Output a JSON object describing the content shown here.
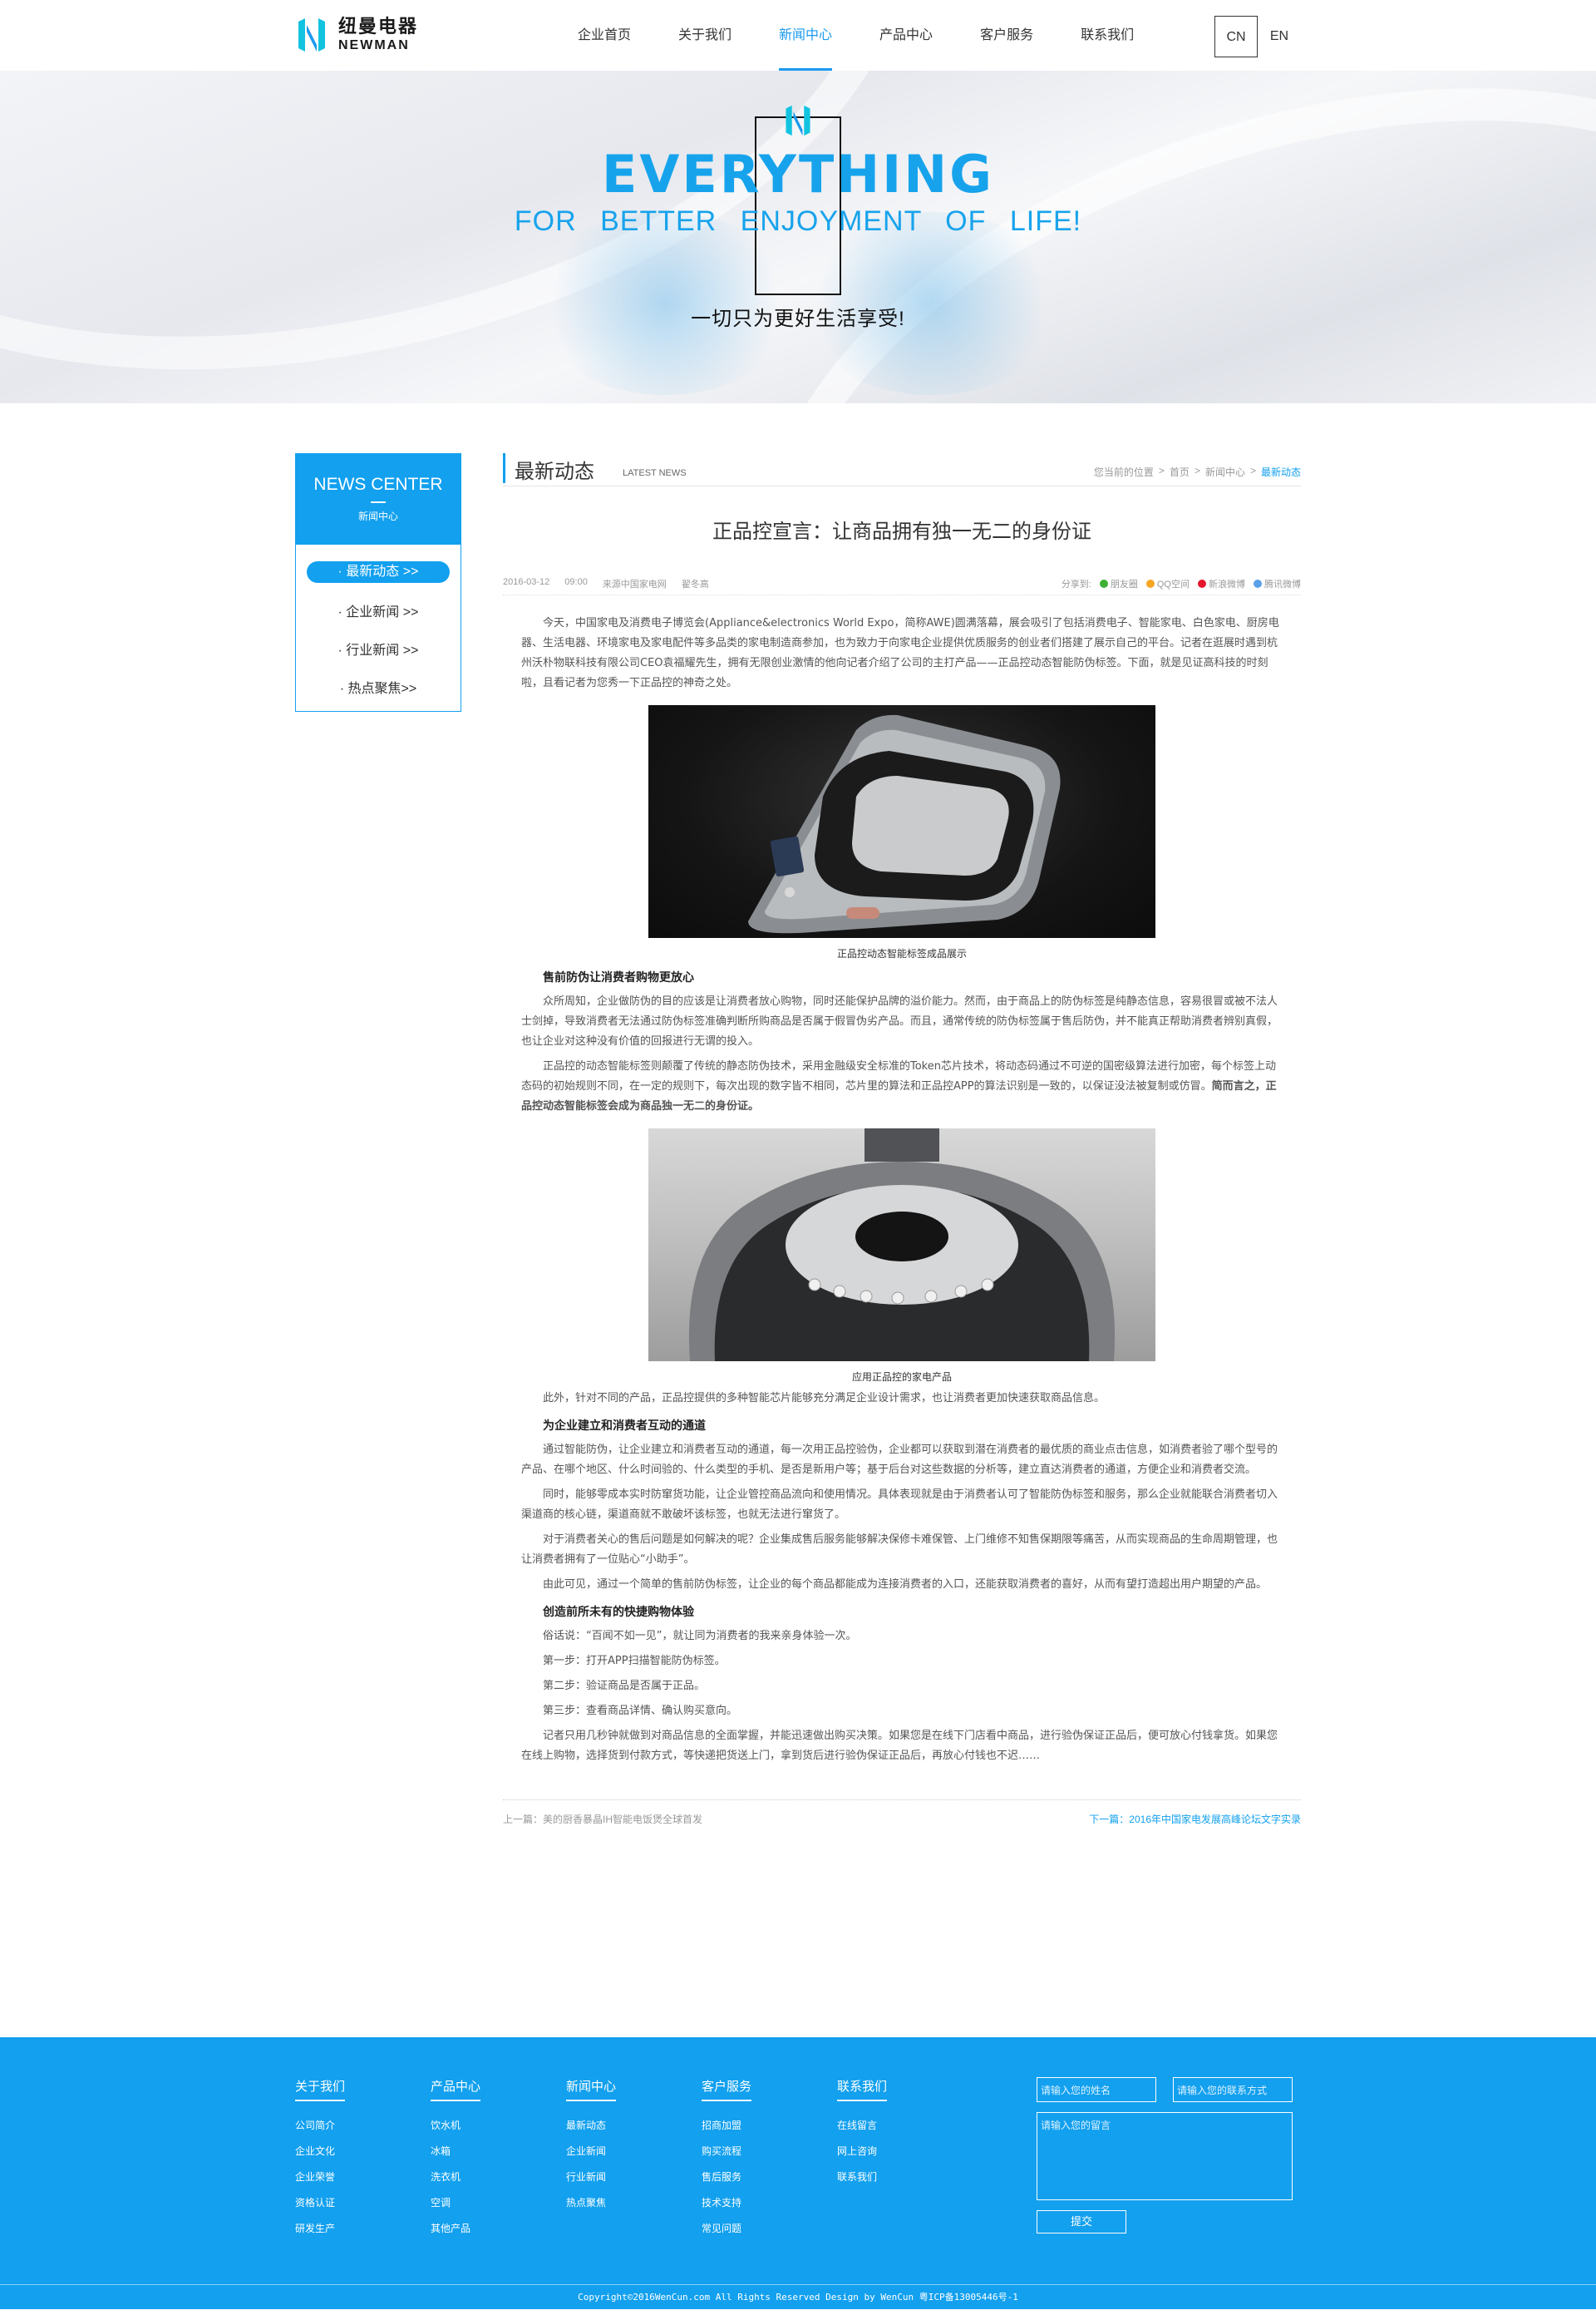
{
  "header": {
    "logo_cn": "纽曼电器",
    "logo_en": "NEWMAN",
    "nav": [
      "企业首页",
      "关于我们",
      "新闻中心",
      "产品中心",
      "客户服务",
      "联系我们"
    ],
    "nav_active_index": 2,
    "lang": [
      "CN",
      "EN"
    ]
  },
  "banner": {
    "title": "EVERYTHING",
    "subtitle": "FOR BETTER ENJOYMENT OF LIFE!",
    "cn": "一切只为更好生活享受!"
  },
  "sidebar": {
    "title_en": "NEWS CENTER",
    "title_cn": "新闻中心",
    "items": [
      "· 最新动态 >>",
      "· 企业新闻 >>",
      "· 行业新闻 >>",
      "· 热点聚焦>>"
    ]
  },
  "content": {
    "title": "最新动态",
    "title_en": "LATEST NEWS",
    "breadcrumb": [
      "您当前的位置",
      ">",
      "首页",
      ">",
      "新闻中心",
      ">",
      "最新动态"
    ]
  },
  "article": {
    "title": "正品控宣言：让商品拥有独一无二的身份证",
    "date": "2016-03-12",
    "time": "09:00",
    "source": "来源中国家电网",
    "author": "翟冬高",
    "share_label": "分享到:",
    "share": [
      "朋友圈",
      "QQ空间",
      "新浪微博",
      "腾讯微博"
    ],
    "p1": "今天，中国家电及消费电子博览会(Appliance&electronics World Expo，简称AWE)圆满落幕，展会吸引了包括消费电子、智能家电、白色家电、厨房电器、生活电器、环境家电及家电配件等多品类的家电制造商参加，也为致力于向家电企业提供优质服务的创业者们搭建了展示自己的平台。记者在逛展时遇到杭州沃朴物联科技有限公司CEO袁福耀先生，拥有无限创业激情的他向记者介绍了公司的主打产品——正品控动态智能防伪标签。下面，就是见证高科技的时刻啦，且看记者为您秀一下正品控的神奇之处。",
    "cap1": "正品控动态智能标签成品展示",
    "h1": "售前防伪让消费者购物更放心",
    "p2": "众所周知，企业做防伪的目的应该是让消费者放心购物，同时还能保护品牌的溢价能力。然而，由于商品上的防伪标签是纯静态信息，容易很冒或被不法人士剑掉，导致消费者无法通过防伪标签准确判断所购商品是否属于假冒伪劣产品。而且，通常传统的防伪标签属于售后防伪，并不能真正帮助消费者辨别真假，也让企业对这种没有价值的回报进行无谓的投入。",
    "p3a": "正品控的动态智能标签则颠覆了传统的静态防伪技术，采用金融级安全标准的Token芯片技术，将动态码通过不可逆的国密级算法进行加密，每个标签上动态码的初始规则不同，在一定的规则下，每次出现的数字皆不相同，芯片里的算法和正品控APP的算法识别是一致的，以保证没法被复制或仿冒。",
    "p3b": "简而言之，正品控动态智能标签会成为商品独一无二的身份证。",
    "cap2": "应用正品控的家电产品",
    "p4": "此外，针对不同的产品，正品控提供的多种智能芯片能够充分满足企业设计需求，也让消费者更加快速获取商品信息。",
    "h2": "为企业建立和消费者互动的通道",
    "p5": "通过智能防伪，让企业建立和消费者互动的通道，每一次用正品控验伪，企业都可以获取到潜在消费者的最优质的商业点击信息，如消费者验了哪个型号的产品、在哪个地区、什么时间验的、什么类型的手机、是否是新用户等；基于后台对这些数据的分析等，建立直达消费者的通道，方便企业和消费者交流。",
    "p6": "同时，能够零成本实时防窜货功能，让企业管控商品流向和使用情况。具体表现就是由于消费者认可了智能防伪标签和服务，那么企业就能联合消费者切入渠道商的核心链，渠道商就不敢破坏该标签，也就无法进行窜货了。",
    "p7": "对于消费者关心的售后问题是如何解决的呢？企业集成售后服务能够解决保修卡难保管、上门维修不知售保期限等痛苦，从而实现商品的生命周期管理，也让消费者拥有了一位贴心“小助手”。",
    "p8": "由此可见，通过一个简单的售前防伪标签，让企业的每个商品都能成为连接消费者的入口，还能获取消费者的喜好，从而有望打造超出用户期望的产品。",
    "h3": "创造前所未有的快捷购物体验",
    "p9": "俗话说：“百闻不如一见”，就让同为消费者的我来亲身体验一次。",
    "p10": "第一步：打开APP扫描智能防伪标签。",
    "p11": "第二步：验证商品是否属于正品。",
    "p12": "第三步：查看商品详情、确认购买意向。",
    "p13": "记者只用几秒钟就做到对商品信息的全面掌握，并能迅速做出购买决策。如果您是在线下门店看中商品，进行验伪保证正品后，便可放心付钱拿货。如果您在线上购物，选择货到付款方式，等快递把货送上门，拿到货后进行验伪保证正品后，再放心付钱也不迟……",
    "prev": "上一篇：美的厨香暴晶IH智能电饭煲全球首发",
    "next": "下一篇：2016年中国家电发展高峰论坛文字实录"
  },
  "footer": {
    "cols": [
      {
        "title": "关于我们",
        "items": [
          "公司简介",
          "企业文化",
          "企业荣誉",
          "资格认证",
          "研发生产"
        ]
      },
      {
        "title": "产品中心",
        "items": [
          "饮水机",
          "冰箱",
          "洗衣机",
          "空调",
          "其他产品"
        ]
      },
      {
        "title": "新闻中心",
        "items": [
          "最新动态",
          "企业新闻",
          "行业新闻",
          "热点聚焦"
        ]
      },
      {
        "title": "客户服务",
        "items": [
          "招商加盟",
          "购买流程",
          "售后服务",
          "技术支持",
          "常见问题"
        ]
      },
      {
        "title": "联系我们",
        "items": [
          "在线留言",
          "网上咨询",
          "联系我们"
        ]
      }
    ],
    "name_placeholder": "请输入您的姓名",
    "contact_placeholder": "请输入您的联系方式",
    "message_placeholder": "请输入您的留言",
    "submit": "提交",
    "copyright": "Copyright©2016WenCun.com All Rights Reserved     Design by WenCun 粤ICP备13005446号-1"
  },
  "colors": {
    "accent": "#12a0ef",
    "banner_text": "#17a3ec"
  }
}
